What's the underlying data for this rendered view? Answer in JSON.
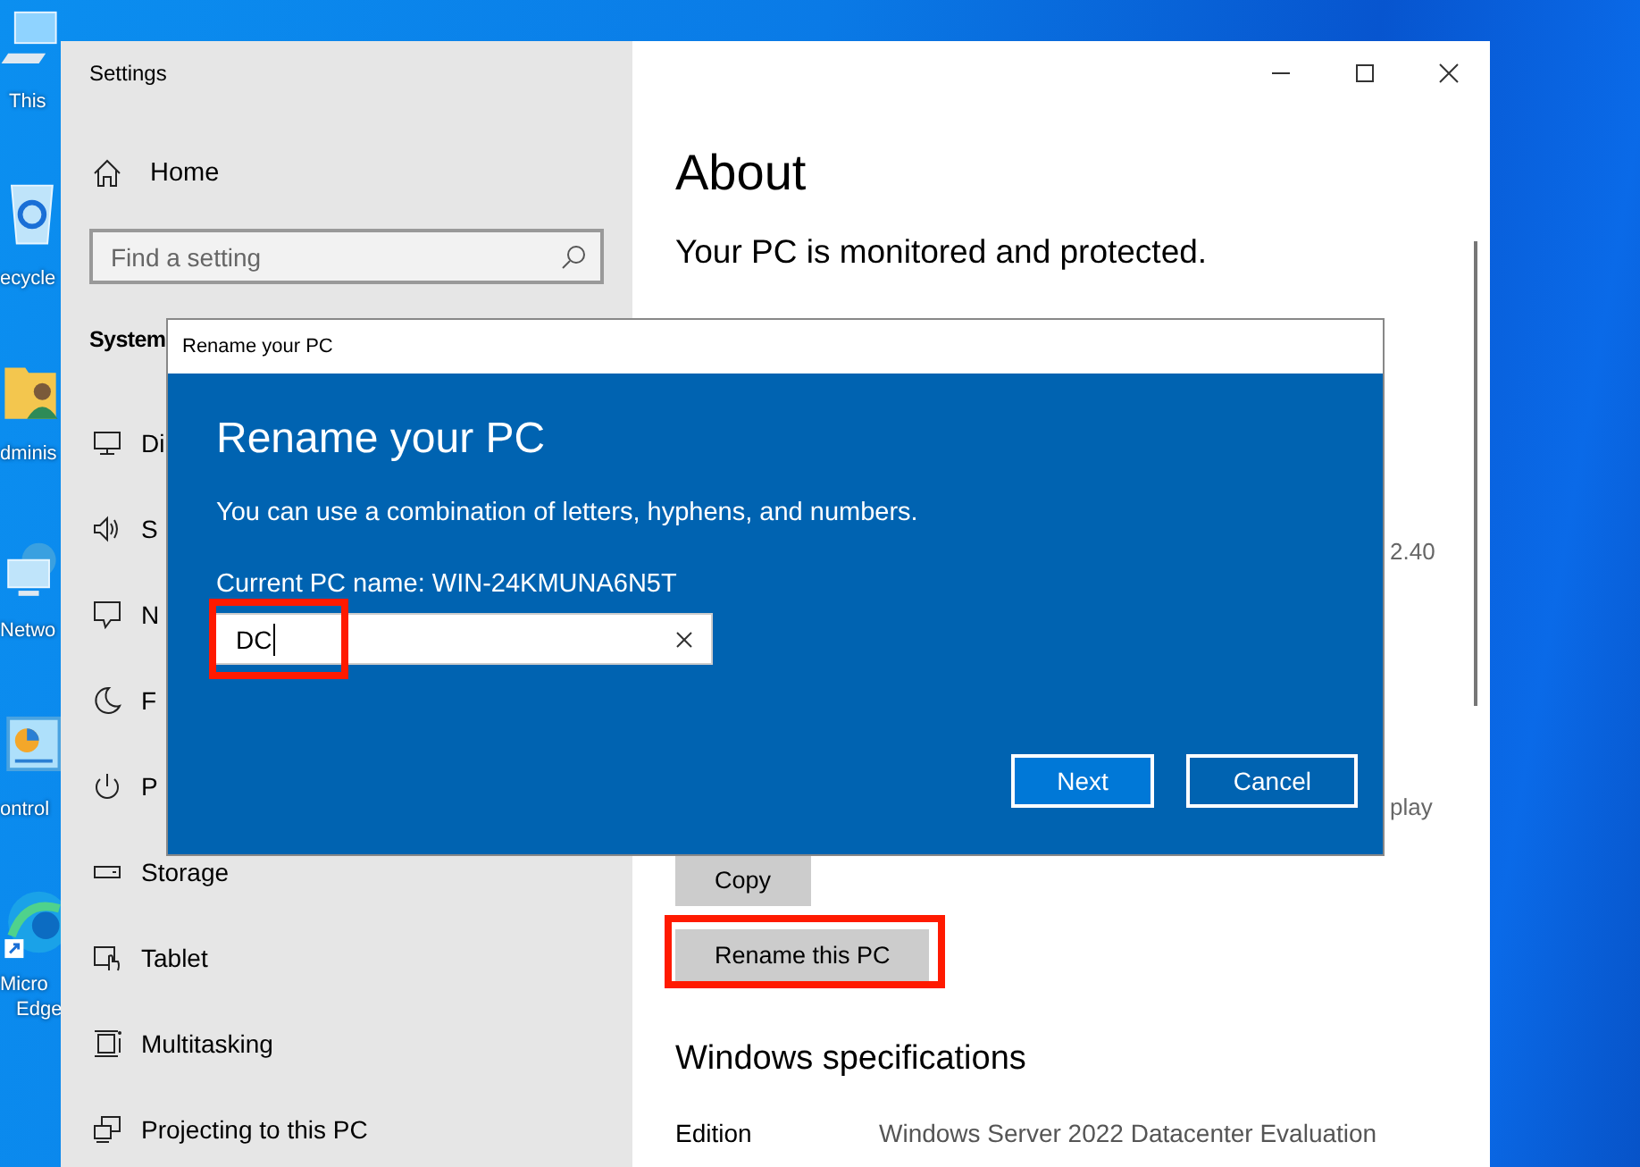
{
  "desktop": {
    "icons": [
      {
        "kind": "computer",
        "lines": [
          "This"
        ]
      },
      {
        "kind": "recycle-bin",
        "lines": [
          "ecycle"
        ]
      },
      {
        "kind": "user-folder",
        "lines": [
          "dminis"
        ]
      },
      {
        "kind": "network",
        "lines": [
          "Netwo"
        ]
      },
      {
        "kind": "control-panel",
        "lines": [
          "ontrol"
        ]
      },
      {
        "kind": "browser",
        "lines": [
          "Micro",
          "Edge"
        ]
      }
    ]
  },
  "window": {
    "title": "Settings",
    "controls": [
      {
        "kind": "minimize"
      },
      {
        "kind": "maximize"
      },
      {
        "kind": "close"
      }
    ]
  },
  "sidebar": {
    "home": "Home",
    "search": {
      "placeholder": "Find a setting"
    },
    "section": "System",
    "items": [
      {
        "kind": "display",
        "label": "Di"
      },
      {
        "kind": "sound",
        "label": "S"
      },
      {
        "kind": "notifications",
        "label": "N"
      },
      {
        "kind": "focus",
        "label": "F"
      },
      {
        "kind": "power",
        "label": "P"
      },
      {
        "kind": "storage",
        "label": "Storage"
      },
      {
        "kind": "tablet",
        "label": "Tablet"
      },
      {
        "kind": "multitasking",
        "label": "Multitasking"
      },
      {
        "kind": "projecting",
        "label": "Projecting to this PC"
      }
    ]
  },
  "content": {
    "title": "About",
    "status": "Your PC is monitored and protected.",
    "partial_texts": [
      "2.40",
      "play"
    ],
    "buttons": [
      {
        "label": "Copy",
        "highlighted": false
      },
      {
        "label": "Rename this PC",
        "highlighted": true
      }
    ],
    "section": "Windows specifications",
    "specs": [
      {
        "label": "Edition",
        "value": "Windows Server 2022 Datacenter Evaluation"
      }
    ]
  },
  "dialog": {
    "title": "Rename your PC",
    "heading": "Rename your PC",
    "description": "You can use a combination of letters, hyphens, and numbers.",
    "current_name": "Current PC name: WIN-24KMUNA6N5T",
    "input": {
      "value": "DC",
      "highlighted": true
    },
    "buttons": [
      {
        "kind": "primary",
        "label": "Next"
      },
      {
        "kind": "secondary",
        "label": "Cancel"
      }
    ]
  }
}
